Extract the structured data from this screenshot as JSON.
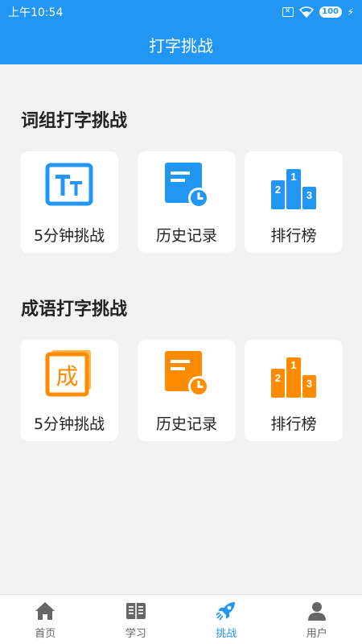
{
  "status_bar": {
    "time": "上午10:54",
    "sim_label": "✕",
    "battery": "100"
  },
  "app_bar": {
    "title": "打字挑战"
  },
  "sections": [
    {
      "title": "词组打字挑战",
      "accent_color": "#2196f3",
      "cards": [
        {
          "label": "5分钟挑战",
          "icon": "tt-text-icon"
        },
        {
          "label": "历史记录",
          "icon": "history-icon"
        },
        {
          "label": "排行榜",
          "icon": "podium-icon"
        }
      ]
    },
    {
      "title": "成语打字挑战",
      "accent_color": "#ff8c00",
      "cards": [
        {
          "label": "5分钟挑战",
          "icon": "cheng-char-icon",
          "icon_text": "成"
        },
        {
          "label": "历史记录",
          "icon": "history-icon"
        },
        {
          "label": "排行榜",
          "icon": "podium-icon"
        }
      ]
    }
  ],
  "podium_numbers": [
    "1",
    "2",
    "3"
  ],
  "tabs": [
    {
      "label": "首页",
      "icon": "home-icon",
      "active": false
    },
    {
      "label": "学习",
      "icon": "book-icon",
      "active": false
    },
    {
      "label": "挑战",
      "icon": "rocket-icon",
      "active": true
    },
    {
      "label": "用户",
      "icon": "user-icon",
      "active": false
    }
  ],
  "colors": {
    "primary": "#2196f3",
    "orange": "#ff8c00",
    "inactive_tab": "#666666"
  }
}
